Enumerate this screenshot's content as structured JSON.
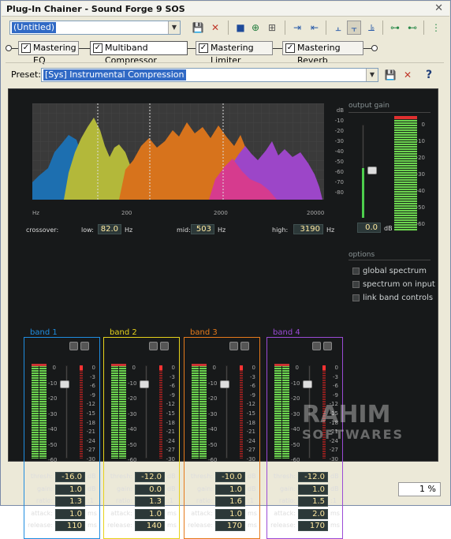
{
  "window": {
    "title": "Plug-In Chainer - Sound Forge 9 SOS",
    "close_glyph": "✕"
  },
  "toolbar": {
    "chain_name": "(Untitled)",
    "icons": [
      "save-icon",
      "delete-icon",
      "bypass-icon",
      "add-plugin-icon",
      "remove-plugin-icon",
      "move-left-icon",
      "move-right-icon",
      "pre-icon",
      "post-icon",
      "auto-icon",
      "add-chain-icon",
      "remove-chain-icon",
      "chain-settings-icon"
    ]
  },
  "chain": {
    "plugins": [
      {
        "label": "Mastering EQ",
        "checked": true
      },
      {
        "label": "Multiband Compressor",
        "checked": true
      },
      {
        "label": "Mastering Limiter",
        "checked": true
      },
      {
        "label": "Mastering Reverb",
        "checked": true
      }
    ]
  },
  "preset": {
    "label": "Preset:",
    "value": "[Sys] Instrumental Compression",
    "help": "?"
  },
  "spectrum": {
    "db_ticks": [
      "dB",
      "-10",
      "-20",
      "-30",
      "-40",
      "-50",
      "-60",
      "-70",
      "-80"
    ],
    "hz_ticks": [
      "Hz",
      "200",
      "2000",
      "20000"
    ]
  },
  "crossover": {
    "label": "crossover:",
    "low": {
      "label": "low:",
      "value": "82.0",
      "unit": "Hz"
    },
    "mid": {
      "label": "mid:",
      "value": "503",
      "unit": "Hz"
    },
    "high": {
      "label": "high:",
      "value": "3190",
      "unit": "Hz"
    }
  },
  "output_gain": {
    "label": "output gain",
    "value": "0.0",
    "unit": "dB",
    "scale": [
      "0",
      "-10",
      "-20",
      "-30",
      "-40",
      "-50",
      "-60"
    ]
  },
  "options": {
    "label": "options",
    "items": [
      "global spectrum",
      "spectrum on input",
      "link band controls"
    ]
  },
  "band_scale": [
    "0",
    "-10",
    "-20",
    "-30",
    "-40",
    "-50",
    "-60"
  ],
  "band_gr_scale": [
    "0",
    "-3",
    "-6",
    "-9",
    "-12",
    "-15",
    "-18",
    "-21",
    "-24",
    "-27",
    "-30"
  ],
  "param_labels": {
    "thresh": "thresh:",
    "gain": "gain:",
    "ratio": "ratio:",
    "attack": "attack:",
    "release": "release:"
  },
  "bands": [
    {
      "name": "band 1",
      "color": "#1f8de0",
      "thresh": "-16.0",
      "gain": "1.0",
      "ratio": "1.3",
      "attack": "1.0",
      "release": "110",
      "units": [
        "dB",
        "dB",
        ":1",
        "ms",
        "ms"
      ]
    },
    {
      "name": "band 2",
      "color": "#e6d21b",
      "thresh": "-12.0",
      "gain": "0.0",
      "ratio": "1.3",
      "attack": "1.0",
      "release": "140",
      "units": [
        "dB",
        "dB",
        ":1",
        "ms",
        "ms"
      ]
    },
    {
      "name": "band 3",
      "color": "#e67a1b",
      "thresh": "-10.0",
      "gain": "1.0",
      "ratio": "1.6",
      "attack": "1.0",
      "release": "170",
      "units": [
        "dB",
        "dB",
        ":1",
        "ms",
        "ms"
      ]
    },
    {
      "name": "band 4",
      "color": "#9b4bd6",
      "thresh": "-12.0",
      "gain": "1.0",
      "ratio": "1.5",
      "attack": "2.0",
      "release": "170",
      "units": [
        "dB",
        "dB",
        ":1",
        "ms",
        "ms"
      ]
    }
  ],
  "status": {
    "percent": "1 %"
  },
  "watermark": {
    "line1": "RAHIM",
    "line2": "SOFTWARES"
  }
}
